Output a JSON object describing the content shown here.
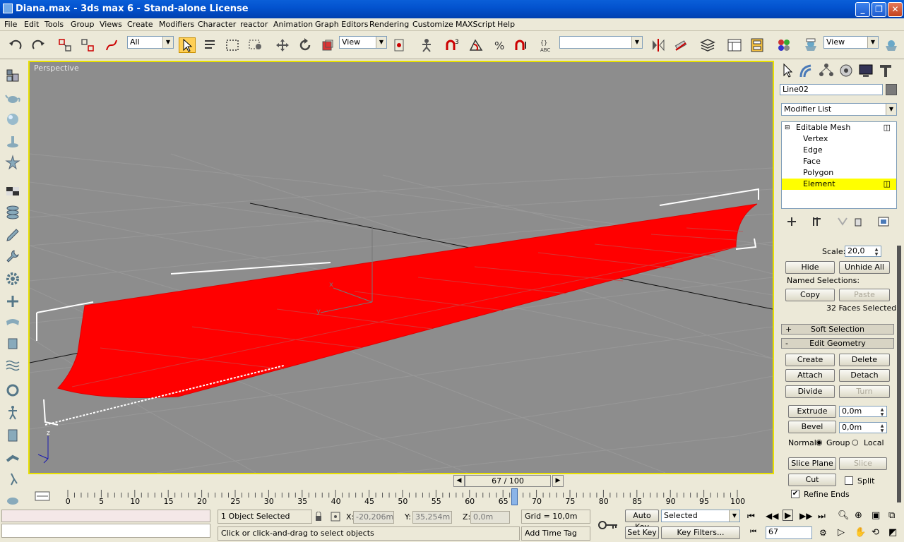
{
  "window": {
    "title": "Diana.max - 3ds max 6 - Stand-alone License"
  },
  "menu": [
    "File",
    "Edit",
    "Tools",
    "Group",
    "Views",
    "Create",
    "Modifiers",
    "Character",
    "reactor",
    "Animation",
    "Graph Editors",
    "Rendering",
    "Customize",
    "MAXScript",
    "Help"
  ],
  "toolbar": {
    "filter_value": "All",
    "ref_coord_value": "View",
    "named_sel_value": "",
    "render_view_value": "View"
  },
  "viewport": {
    "label": "Perspective",
    "gizmo_x": "x",
    "gizmo_y": "y",
    "gizmo_z": "z"
  },
  "time": {
    "slider_label": "67 / 100",
    "ticks": [
      "0",
      "5",
      "10",
      "15",
      "20",
      "25",
      "30",
      "35",
      "40",
      "45",
      "50",
      "55",
      "60",
      "65",
      "70",
      "75",
      "80",
      "85",
      "90",
      "95",
      "100"
    ]
  },
  "command_panel": {
    "object_name": "Line02",
    "modifier_list": "Modifier List",
    "stack": [
      "Editable Mesh",
      "Vertex",
      "Edge",
      "Face",
      "Polygon",
      "Element"
    ],
    "scale_label": "Scale:",
    "scale_value": "20,0",
    "hide": "Hide",
    "unhide_all": "Unhide All",
    "named_selections": "Named Selections:",
    "copy": "Copy",
    "paste": "Paste",
    "faces_selected": "32 Faces Selected",
    "soft_selection": "Soft Selection",
    "edit_geometry": "Edit Geometry",
    "create": "Create",
    "delete": "Delete",
    "attach": "Attach",
    "detach": "Detach",
    "divide": "Divide",
    "turn": "Turn",
    "extrude": "Extrude",
    "extrude_value": "0,0m",
    "bevel": "Bevel",
    "bevel_value": "0,0m",
    "normal_label": "Normal:",
    "group": "Group",
    "local": "Local",
    "slice_plane": "Slice Plane",
    "slice": "Slice",
    "cut": "Cut",
    "split": "Split",
    "refine_ends": "Refine Ends"
  },
  "status": {
    "selection": "1 Object Selected",
    "prompt": "Click or click-and-drag to select objects",
    "x_label": "X:",
    "x_value": "-20,206m",
    "y_label": "Y:",
    "y_value": "35,254m",
    "z_label": "Z:",
    "z_value": "0,0m",
    "grid": "Grid = 10,0m",
    "add_time_tag": "Add Time Tag",
    "auto_key": "Auto Key",
    "set_key": "Set Key",
    "key_mode": "Selected",
    "key_filters": "Key Filters...",
    "frame": "67"
  },
  "colors": {
    "viewport_bg": "#8d8d8d",
    "selection": "#ff0000",
    "active_border": "#e8e000",
    "highlight": "#ffff00"
  }
}
